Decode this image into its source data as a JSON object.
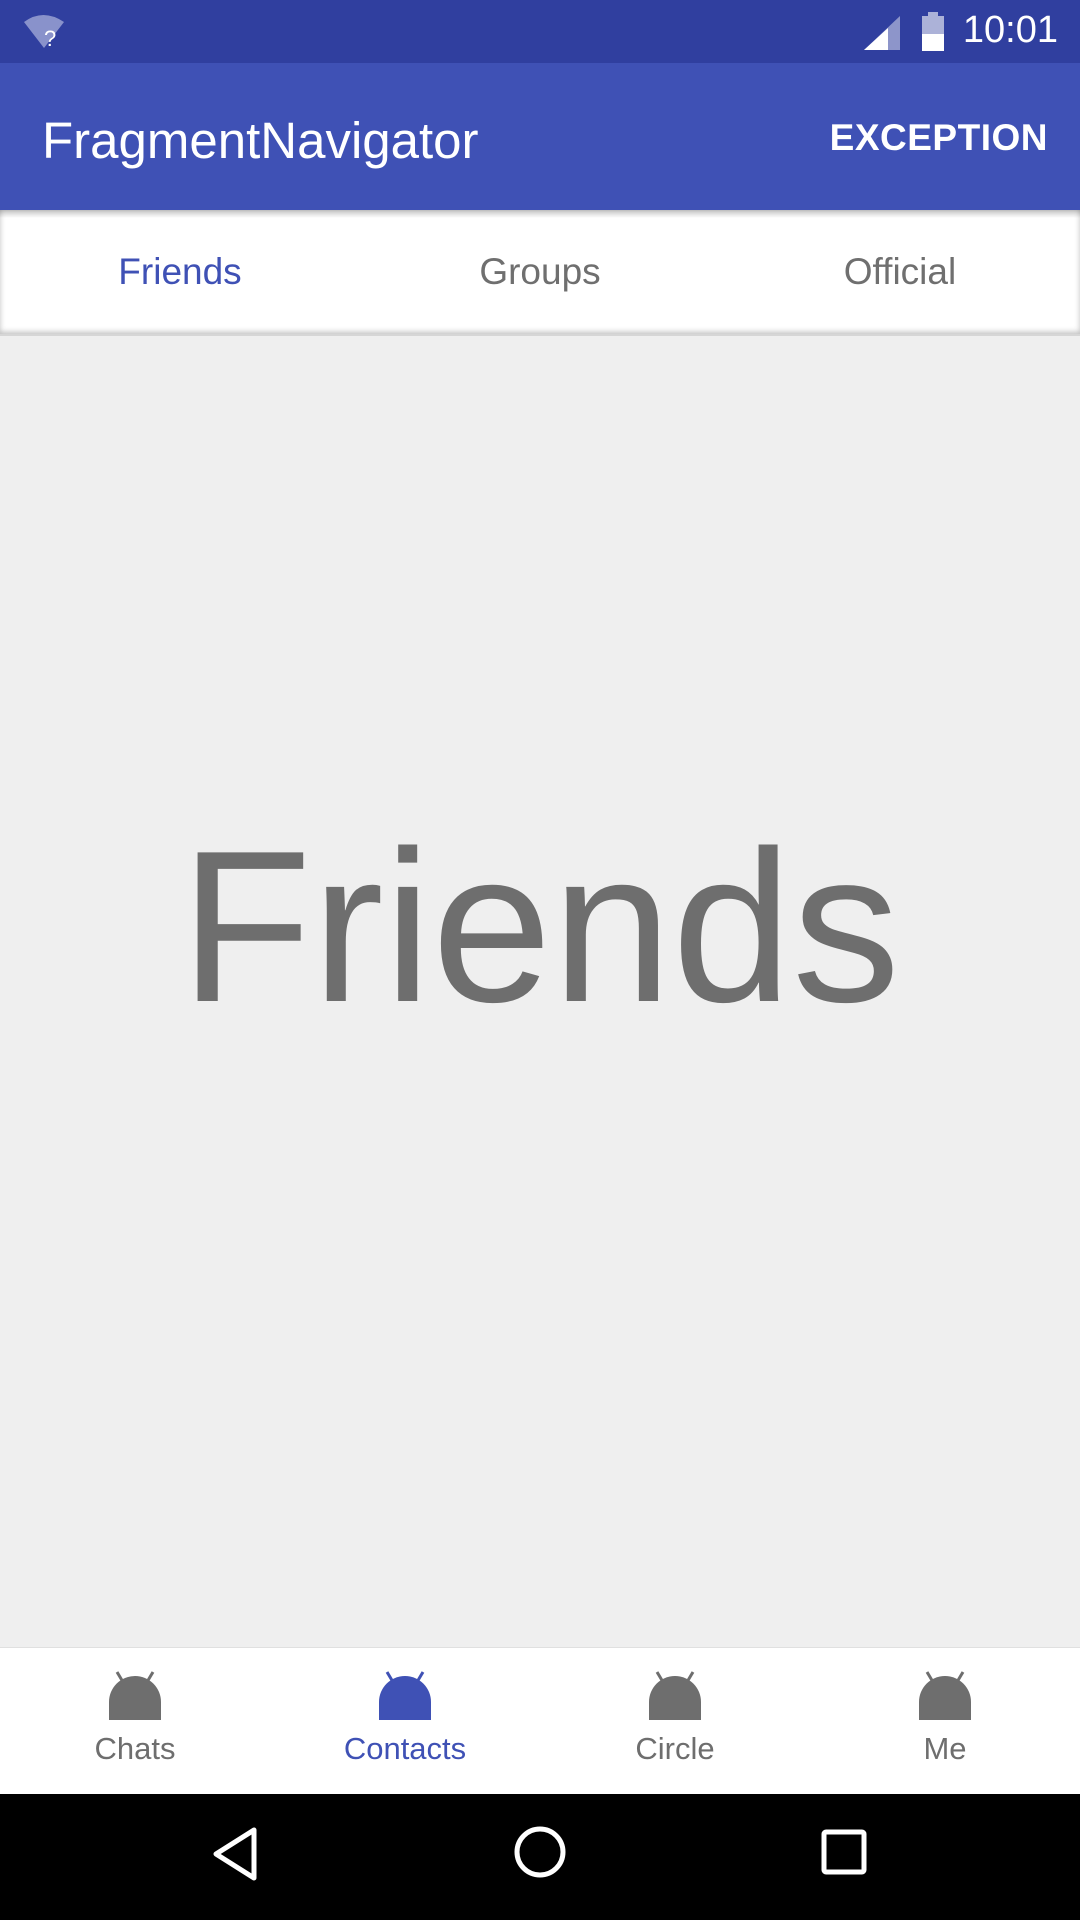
{
  "status_bar": {
    "time": "10:01",
    "wifi_icon": "wifi-question-icon",
    "signal_icon": "cell-signal-icon",
    "battery_icon": "battery-icon"
  },
  "app_bar": {
    "title": "FragmentNavigator",
    "action": "EXCEPTION",
    "color": "#3f51b5"
  },
  "top_tabs": [
    {
      "label": "Friends",
      "active": true
    },
    {
      "label": "Groups",
      "active": false
    },
    {
      "label": "Official",
      "active": false
    }
  ],
  "content": {
    "title": "Friends"
  },
  "bottom_nav": [
    {
      "label": "Chats",
      "icon": "android-icon",
      "active": false
    },
    {
      "label": "Contacts",
      "icon": "android-icon",
      "active": true
    },
    {
      "label": "Circle",
      "icon": "android-icon",
      "active": false
    },
    {
      "label": "Me",
      "icon": "android-icon",
      "active": false
    }
  ],
  "system_nav": {
    "back_icon": "back-triangle-icon",
    "home_icon": "home-circle-icon",
    "recents_icon": "recents-square-icon"
  },
  "colors": {
    "status_bar": "#303f9f",
    "accent": "#3f51b5",
    "inactive": "#6e6e6e",
    "background": "#efefef"
  }
}
